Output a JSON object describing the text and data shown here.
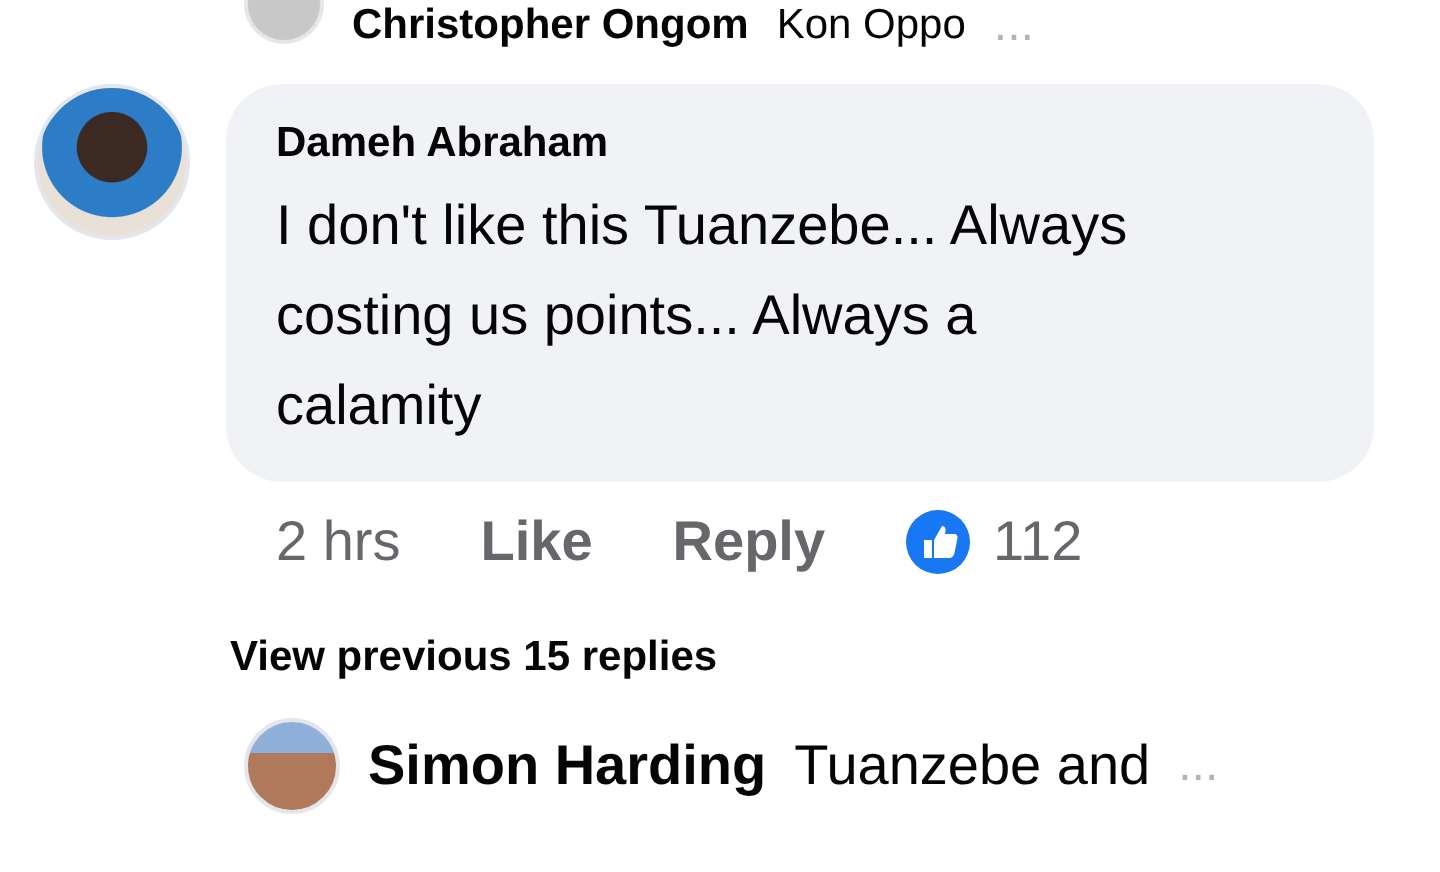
{
  "previous_reply": {
    "author": "Christopher Ongom",
    "text": "Kon Oppo",
    "more": "..."
  },
  "comment": {
    "author": "Dameh Abraham",
    "text": "I don't like this Tuanzebe...  Always costing us points... Always a calamity",
    "time": "2 hrs",
    "like": "Like",
    "reply": "Reply",
    "reactions": "112"
  },
  "view_previous": "View previous 15 replies",
  "reply": {
    "author": "Simon Harding",
    "text": "Tuanzebe and",
    "more": "..."
  }
}
